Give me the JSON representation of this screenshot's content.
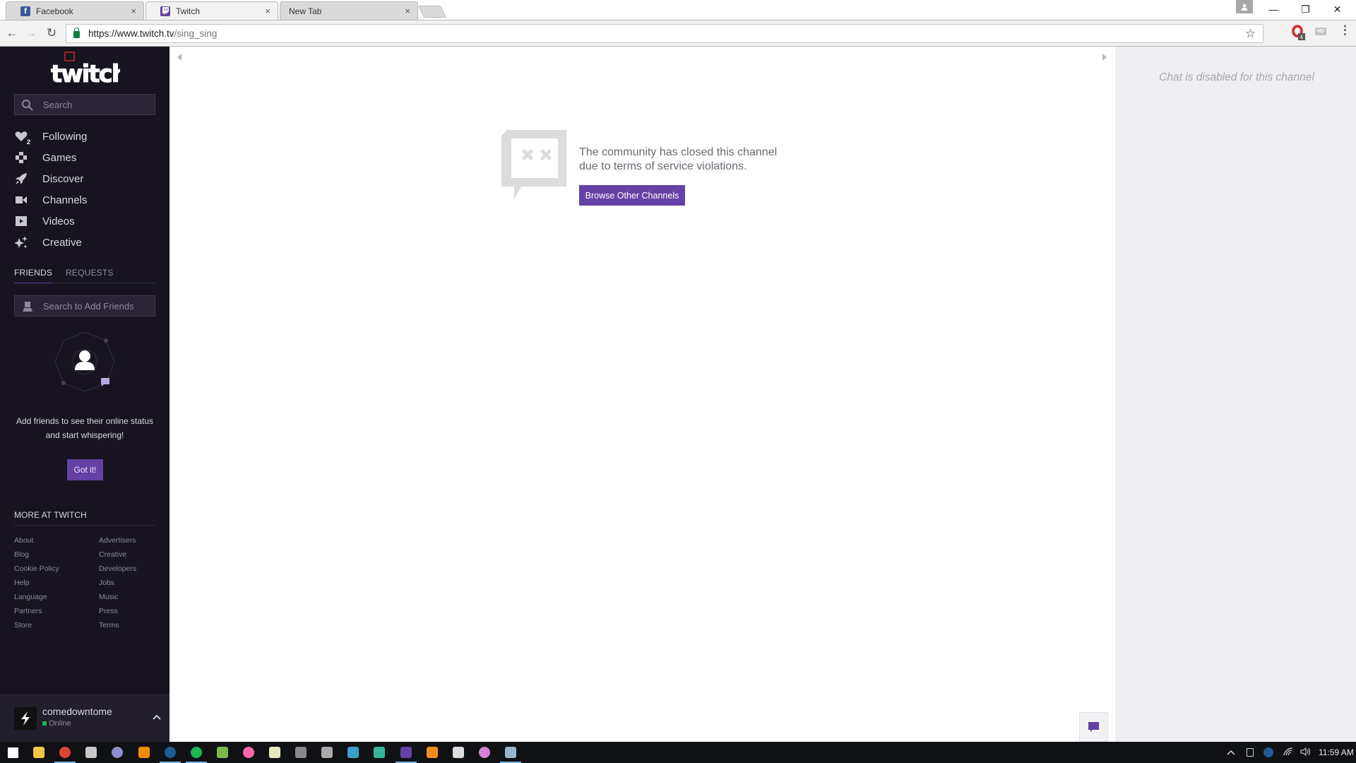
{
  "browser": {
    "tabs": [
      {
        "title": "Facebook",
        "favicon": "facebook-icon",
        "active": false
      },
      {
        "title": "Twitch",
        "favicon": "twitch-icon",
        "active": true
      },
      {
        "title": "New Tab",
        "favicon": "",
        "active": false
      }
    ],
    "close_glyph": "×",
    "url_host": "https://www.twitch.tv",
    "url_path": "/sing_sing",
    "star_glyph": "☆",
    "back_glyph": "←",
    "forward_glyph": "→",
    "reload_glyph": "↻",
    "window_controls": {
      "minimize": "—",
      "restore": "❐",
      "close": "✕"
    },
    "extensions": [
      {
        "name": "opera-vpn-extension",
        "badge": "4"
      },
      {
        "name": "hd-extension",
        "label": "HD"
      }
    ],
    "menu_glyph": "⋮"
  },
  "sidebar": {
    "search_placeholder": "Search",
    "nav": [
      {
        "label": "Following",
        "icon": "heart-icon",
        "badge": "2"
      },
      {
        "label": "Games",
        "icon": "gamepad-icon"
      },
      {
        "label": "Discover",
        "icon": "rocket-icon"
      },
      {
        "label": "Channels",
        "icon": "video-camera-icon"
      },
      {
        "label": "Videos",
        "icon": "play-icon"
      },
      {
        "label": "Creative",
        "icon": "sparkle-icon"
      }
    ],
    "friends_tabs": [
      {
        "label": "FRIENDS",
        "active": true
      },
      {
        "label": "REQUESTS",
        "active": false
      }
    ],
    "friend_search_placeholder": "Search to Add Friends",
    "empty_line1": "Add friends to see their online status",
    "empty_line2": "and start whispering!",
    "got_it_label": "Got it!",
    "more_heading": "MORE AT TWITCH",
    "links_left": [
      "About",
      "Blog",
      "Cookie Policy",
      "Help",
      "Language",
      "Partners",
      "Store"
    ],
    "links_right": [
      "Advertisers",
      "Creative",
      "Developers",
      "Jobs",
      "Music",
      "Press",
      "Terms"
    ],
    "user": {
      "name": "comedowntome",
      "status": "Online",
      "status_color": "#1db954"
    }
  },
  "main": {
    "message_line1": "The community has closed this channel",
    "message_line2": "due to terms of service violations.",
    "browse_button": "Browse Other Channels"
  },
  "chat": {
    "disabled_text": "Chat is disabled for this channel"
  },
  "colors": {
    "twitch_purple": "#6441a4",
    "sidebar_bg": "#17141f",
    "chat_bg": "#efeef1"
  },
  "taskbar": {
    "apps": [
      "start-button",
      "file-explorer",
      "chrome",
      "utility-app",
      "bittorrent",
      "vlc",
      "steam",
      "spotify",
      "notepad",
      "osu",
      "99-app",
      "tw-app",
      "ccleaner-app",
      "nox-app",
      "discord",
      "twitch-app",
      "blender",
      "be-app",
      "itunes",
      "network-monitor"
    ],
    "clock": "11:59 AM",
    "tray_chevron": "^"
  }
}
